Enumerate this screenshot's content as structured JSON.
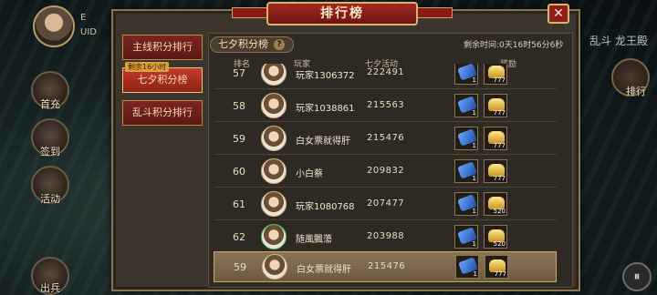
{
  "player": {
    "e_label": "E",
    "uid_label": "UID"
  },
  "side_buttons": [
    {
      "label": "首充"
    },
    {
      "label": "签到"
    },
    {
      "label": "活动"
    },
    {
      "label": "出兵"
    }
  ],
  "right_panel": {
    "top_text": "乱斗 龙王殿",
    "button_label": "排行",
    "pause_symbol": "⏸"
  },
  "panel": {
    "title": "排行榜",
    "close_symbol": "✕",
    "tabs": [
      {
        "label": "主线积分排行",
        "badge": ""
      },
      {
        "label": "七夕积分榜",
        "badge": "剩余16小时"
      },
      {
        "label": "乱斗积分排行",
        "badge": ""
      }
    ],
    "sub_title": "七夕积分榜",
    "help_symbol": "?",
    "timer": "剩余时间:0天16时56分6秒",
    "columns": {
      "rank": "排名",
      "player": "玩家",
      "score": "七夕活动",
      "reward": "奖励"
    },
    "rows": [
      {
        "rank": "57",
        "name": "玩家1306372",
        "score": "222491",
        "reward1_qty": "1",
        "reward2_qty": "777",
        "green": false,
        "mine": false
      },
      {
        "rank": "58",
        "name": "玩家1038861",
        "score": "215563",
        "reward1_qty": "1",
        "reward2_qty": "777",
        "green": false,
        "mine": false
      },
      {
        "rank": "59",
        "name": "白女票就得肝",
        "score": "215476",
        "reward1_qty": "1",
        "reward2_qty": "777",
        "green": false,
        "mine": false
      },
      {
        "rank": "60",
        "name": "小白蔡",
        "score": "209832",
        "reward1_qty": "1",
        "reward2_qty": "777",
        "green": false,
        "mine": false
      },
      {
        "rank": "61",
        "name": "玩家1080768",
        "score": "207477",
        "reward1_qty": "1",
        "reward2_qty": "520",
        "green": false,
        "mine": false
      },
      {
        "rank": "62",
        "name": "随風飄蕩",
        "score": "203988",
        "reward1_qty": "1",
        "reward2_qty": "520",
        "green": true,
        "mine": false
      },
      {
        "rank": "59",
        "name": "白女票就得肝",
        "score": "215476",
        "reward1_qty": "1",
        "reward2_qty": "777",
        "green": false,
        "mine": true
      }
    ]
  }
}
